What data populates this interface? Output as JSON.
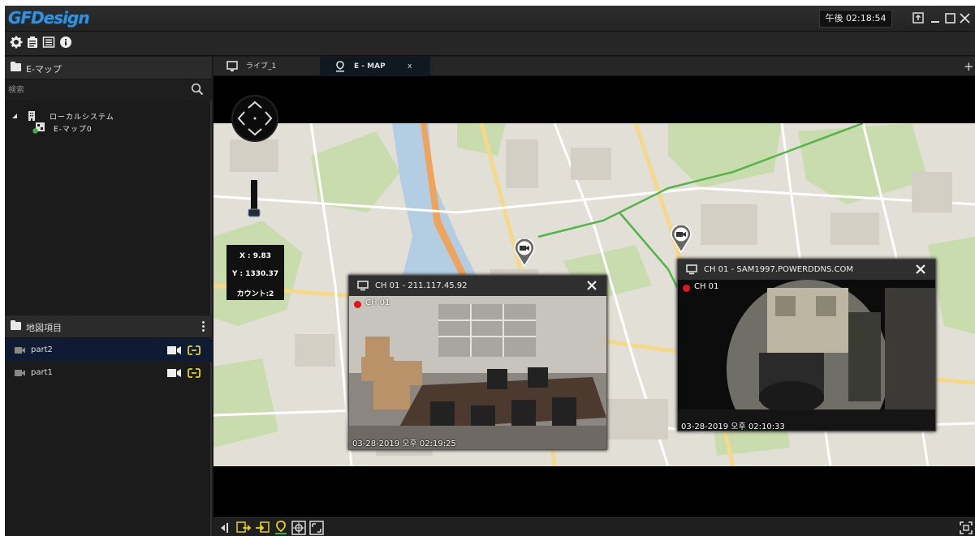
{
  "app": {
    "logo": "GFDesign",
    "clock": "午後 02:18:54"
  },
  "left_panel": {
    "emap_header": "E-マップ",
    "search_placeholder": "検索",
    "tree": {
      "root_label": "ローカルシステム",
      "child_label": "E-マップ0"
    },
    "map_items_header": "地図項目",
    "map_items": [
      {
        "label": "part2",
        "selected": true
      },
      {
        "label": "part1",
        "selected": false
      }
    ]
  },
  "tabs": [
    {
      "label": "ライブ_1",
      "icon": "monitor-icon",
      "active": false
    },
    {
      "label": "E - MAP",
      "icon": "map-pin-icon",
      "active": true,
      "close_label": "x"
    }
  ],
  "map": {
    "coords": {
      "x_label": "X : 9.83",
      "y_label": "Y : 1330.37",
      "count_label": "カウント:2"
    },
    "camera_windows": [
      {
        "title": "CH 01 - 211.117.45.92",
        "channel": "CH 01",
        "timestamp": "03-28-2019 오후 02:19:25"
      },
      {
        "title": "CH 01 - SAM1997.POWERDDNS.COM",
        "channel": "CH 01",
        "timestamp": "03-28-2019 오후 02:10:33"
      }
    ]
  },
  "colors": {
    "accent_blue": "#3a8fd6",
    "record_red": "#e0151b",
    "link_yellow": "#e2d21b",
    "selected_row": "#0f1a33"
  }
}
